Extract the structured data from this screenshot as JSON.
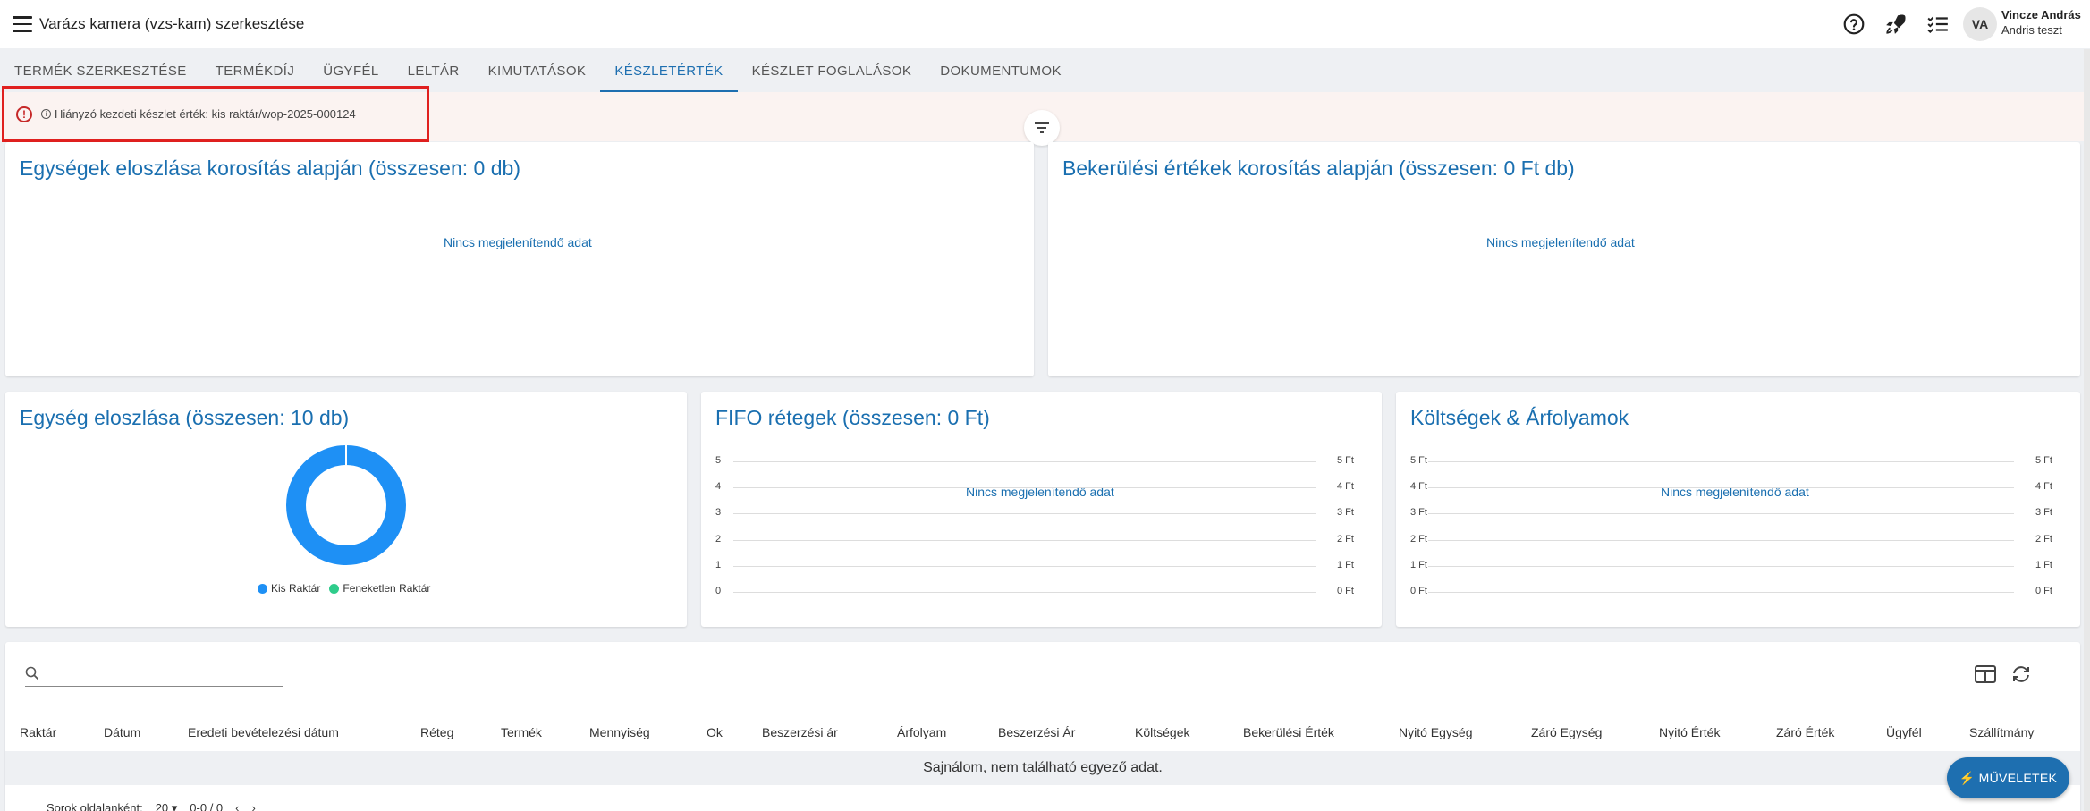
{
  "header": {
    "title": "Varázs kamera (vzs-kam) szerkesztése",
    "user_initials": "VA",
    "user_name": "Vincze András",
    "user_sub": "Andris teszt"
  },
  "tabs": [
    {
      "label": "TERMÉK SZERKESZTÉSE"
    },
    {
      "label": "TERMÉKDÍJ"
    },
    {
      "label": "ÜGYFÉL"
    },
    {
      "label": "LELTÁR"
    },
    {
      "label": "KIMUTATÁSOK"
    },
    {
      "label": "KÉSZLETÉRTÉK"
    },
    {
      "label": "KÉSZLET FOGLALÁSOK"
    },
    {
      "label": "DOKUMENTUMOK"
    }
  ],
  "active_tab": "KÉSZLETÉRTÉK",
  "banner": {
    "text": "Hiányzó kezdeti készlet érték: kis raktár/wop-2025-000124",
    "color": "#e0201f"
  },
  "cards": {
    "aging_units": {
      "title": "Egységek eloszlása korosítás alapján (összesen: 0 db)",
      "nodata": "Nincs megjelenítendő adat"
    },
    "aging_values": {
      "title": "Bekerülési értékek korosítás alapján (összesen: 0 Ft db)",
      "nodata": "Nincs megjelenítendő adat"
    },
    "unit_dist": {
      "title": "Egység eloszlása (összesen: 10 db)"
    },
    "fifo": {
      "title": "FIFO rétegek (összesen: 0 Ft)",
      "nodata": "Nincs megjelenítendő adat"
    },
    "costs": {
      "title": "Költségek & Árfolyamok",
      "nodata": "Nincs megjelenítendő adat"
    }
  },
  "chart_data": [
    {
      "type": "pie",
      "title": "Egység eloszlása (összesen: 10 db)",
      "labels": [
        "Kis Raktár",
        "Feneketlen Raktár"
      ],
      "values": [
        10,
        0
      ],
      "colors": [
        "#1e90f5",
        "#2ecc8b"
      ],
      "legend": "bottom"
    },
    {
      "type": "line",
      "title": "FIFO rétegek (összesen: 0 Ft)",
      "y_left_ticks": [
        "0",
        "1",
        "2",
        "3",
        "4",
        "5"
      ],
      "y_right_ticks": [
        "0 Ft",
        "1 Ft",
        "2 Ft",
        "3 Ft",
        "4 Ft",
        "5 Ft"
      ],
      "ylim": [
        0,
        5
      ],
      "series": [],
      "grid": true
    },
    {
      "type": "line",
      "title": "Költségek & Árfolyamok",
      "y_left_ticks": [
        "0 Ft",
        "1 Ft",
        "2 Ft",
        "3 Ft",
        "4 Ft",
        "5 Ft"
      ],
      "y_right_ticks": [
        "0 Ft",
        "1 Ft",
        "2 Ft",
        "3 Ft",
        "4 Ft",
        "5 Ft"
      ],
      "ylim": [
        0,
        5
      ],
      "series": [],
      "grid": true
    }
  ],
  "table": {
    "search_placeholder": "",
    "columns": [
      "Raktár",
      "Dátum",
      "Eredeti bevételezési dátum",
      "Réteg",
      "Termék",
      "Mennyiség",
      "Ok",
      "Beszerzési ár",
      "Árfolyam",
      "Beszerzési Ár",
      "Költségek",
      "Bekerülési Érték",
      "Nyitó Egység",
      "Záró Egység",
      "Nyitó Érték",
      "Záró Érték",
      "Ügyfél",
      "Szállítmány"
    ],
    "empty_text": "Sajnálom, nem található egyező adat.",
    "rows_per_page_label": "Sorok oldalanként:",
    "rows_per_page": "20",
    "range": "0-0 / 0"
  },
  "fab_label": "MŰVELETEK"
}
